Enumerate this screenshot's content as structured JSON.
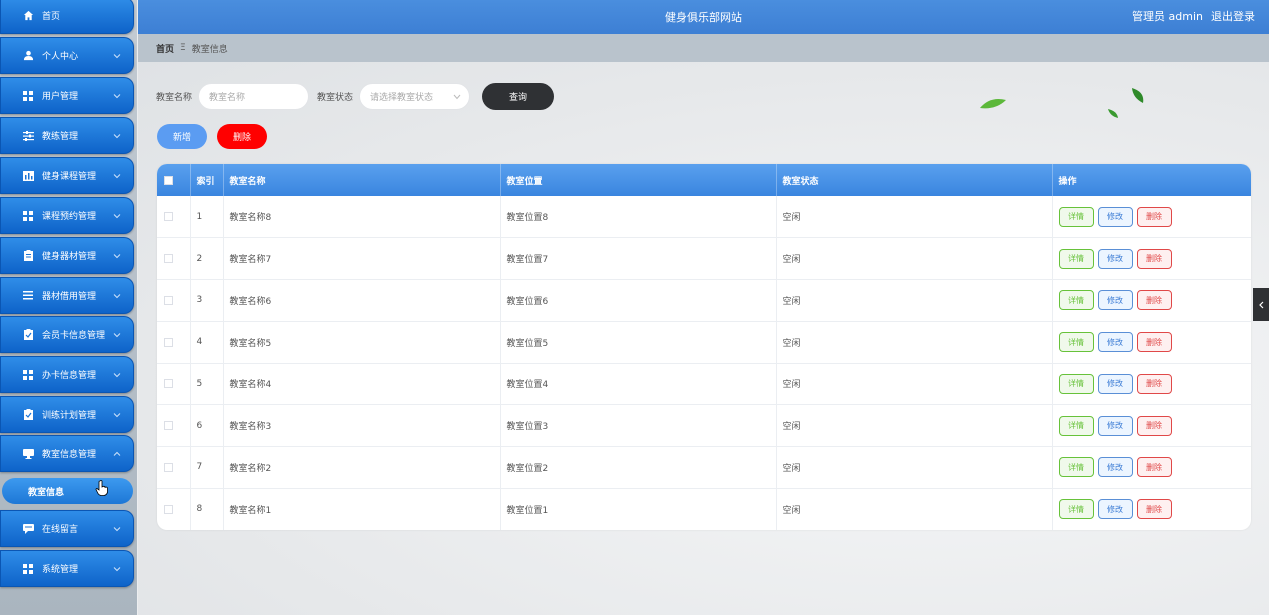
{
  "header": {
    "title": "健身俱乐部网站",
    "user": "管理员 admin",
    "logout": "退出登录"
  },
  "breadcrumb": {
    "home": "首页",
    "separator": "Ξ",
    "current": "教室信息"
  },
  "sidebar": {
    "items": [
      {
        "label": "首页",
        "icon": "home-icon"
      },
      {
        "label": "个人中心",
        "icon": "user-icon"
      },
      {
        "label": "用户管理",
        "icon": "grid-icon"
      },
      {
        "label": "教练管理",
        "icon": "sliders-icon"
      },
      {
        "label": "健身课程管理",
        "icon": "bar-chart-icon"
      },
      {
        "label": "课程预约管理",
        "icon": "grid-icon"
      },
      {
        "label": "健身器材管理",
        "icon": "clipboard-icon"
      },
      {
        "label": "器材借用管理",
        "icon": "list-icon"
      },
      {
        "label": "会员卡信息管理",
        "icon": "checklist-icon"
      },
      {
        "label": "办卡信息管理",
        "icon": "grid-icon"
      },
      {
        "label": "训练计划管理",
        "icon": "checklist-icon"
      },
      {
        "label": "教室信息管理",
        "icon": "monitor-icon"
      },
      {
        "label": "在线留言",
        "icon": "chat-icon"
      },
      {
        "label": "系统管理",
        "icon": "grid-icon"
      }
    ],
    "active_sub": "教室信息"
  },
  "search": {
    "name_label": "教室名称",
    "name_placeholder": "教室名称",
    "status_label": "教室状态",
    "status_placeholder": "请选择教室状态",
    "query_button": "查询"
  },
  "actions": {
    "add": "新增",
    "delete": "删除"
  },
  "table": {
    "headers": [
      "索引",
      "教室名称",
      "教室位置",
      "教室状态",
      "操作"
    ],
    "rows": [
      {
        "index": "1",
        "name": "教室名称8",
        "location": "教室位置8",
        "status": "空闲"
      },
      {
        "index": "2",
        "name": "教室名称7",
        "location": "教室位置7",
        "status": "空闲"
      },
      {
        "index": "3",
        "name": "教室名称6",
        "location": "教室位置6",
        "status": "空闲"
      },
      {
        "index": "4",
        "name": "教室名称5",
        "location": "教室位置5",
        "status": "空闲"
      },
      {
        "index": "5",
        "name": "教室名称4",
        "location": "教室位置4",
        "status": "空闲"
      },
      {
        "index": "6",
        "name": "教室名称3",
        "location": "教室位置3",
        "status": "空闲"
      },
      {
        "index": "7",
        "name": "教室名称2",
        "location": "教室位置2",
        "status": "空闲"
      },
      {
        "index": "8",
        "name": "教室名称1",
        "location": "教室位置1",
        "status": "空闲"
      }
    ],
    "op_labels": {
      "detail": "详情",
      "edit": "修改",
      "remove": "删除"
    }
  },
  "colors": {
    "header": "#4a8ede",
    "sidebar_item": "#1a73d6",
    "query_button": "#2f3134",
    "add_button": "#5b9cf2",
    "delete_button": "#ff0000",
    "detail": "#67c23a",
    "edit": "#3a7bd5",
    "remove": "#e04848"
  }
}
